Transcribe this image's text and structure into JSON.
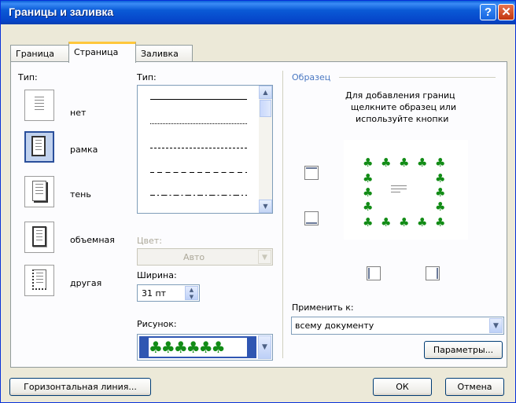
{
  "window": {
    "title": "Границы и заливка",
    "help_glyph": "?",
    "close_glyph": "✕"
  },
  "tabs": [
    {
      "label": "Граница",
      "active": false
    },
    {
      "label": "Страница",
      "active": true
    },
    {
      "label": "Заливка",
      "active": false
    }
  ],
  "setting": {
    "label": "Тип:",
    "items": [
      {
        "label": "нет",
        "selected": false
      },
      {
        "label": "рамка",
        "selected": true
      },
      {
        "label": "тень",
        "selected": false
      },
      {
        "label": "объемная",
        "selected": false
      },
      {
        "label": "другая",
        "selected": false
      }
    ]
  },
  "style": {
    "label": "Тип:",
    "line_styles": [
      "solid",
      "dotted-fine",
      "dashed-fine",
      "dashed",
      "dash-dot"
    ]
  },
  "color": {
    "label": "Цвет:",
    "value": "Авто",
    "enabled": false
  },
  "width": {
    "label": "Ширина:",
    "value": "31 пт"
  },
  "art": {
    "label": "Рисунок:",
    "preview_glyphs": "♣♣♣♣♣♣"
  },
  "preview": {
    "label": "Образец",
    "hint_lines": [
      "Для добавления границ",
      "щелкните образец или",
      "используйте кнопки"
    ],
    "tree_glyph": "♣"
  },
  "apply_to": {
    "label": "Применить к:",
    "value": "всему документу"
  },
  "buttons": {
    "options": "Параметры...",
    "horizontal_line": "Горизонтальная линия...",
    "ok": "ОК",
    "cancel": "Отмена"
  },
  "colors": {
    "title_bar": "#0a5ad6",
    "dialog_bg": "#ece9d8",
    "art_green": "#138c17",
    "art_frame": "#2f56b2",
    "tab_highlight": "#ffc73c"
  },
  "icons": {
    "help": "question-icon",
    "close": "close-icon",
    "scroll_up": "arrow-up-icon",
    "scroll_down": "arrow-down-icon",
    "dropdown": "chevron-down-icon"
  }
}
